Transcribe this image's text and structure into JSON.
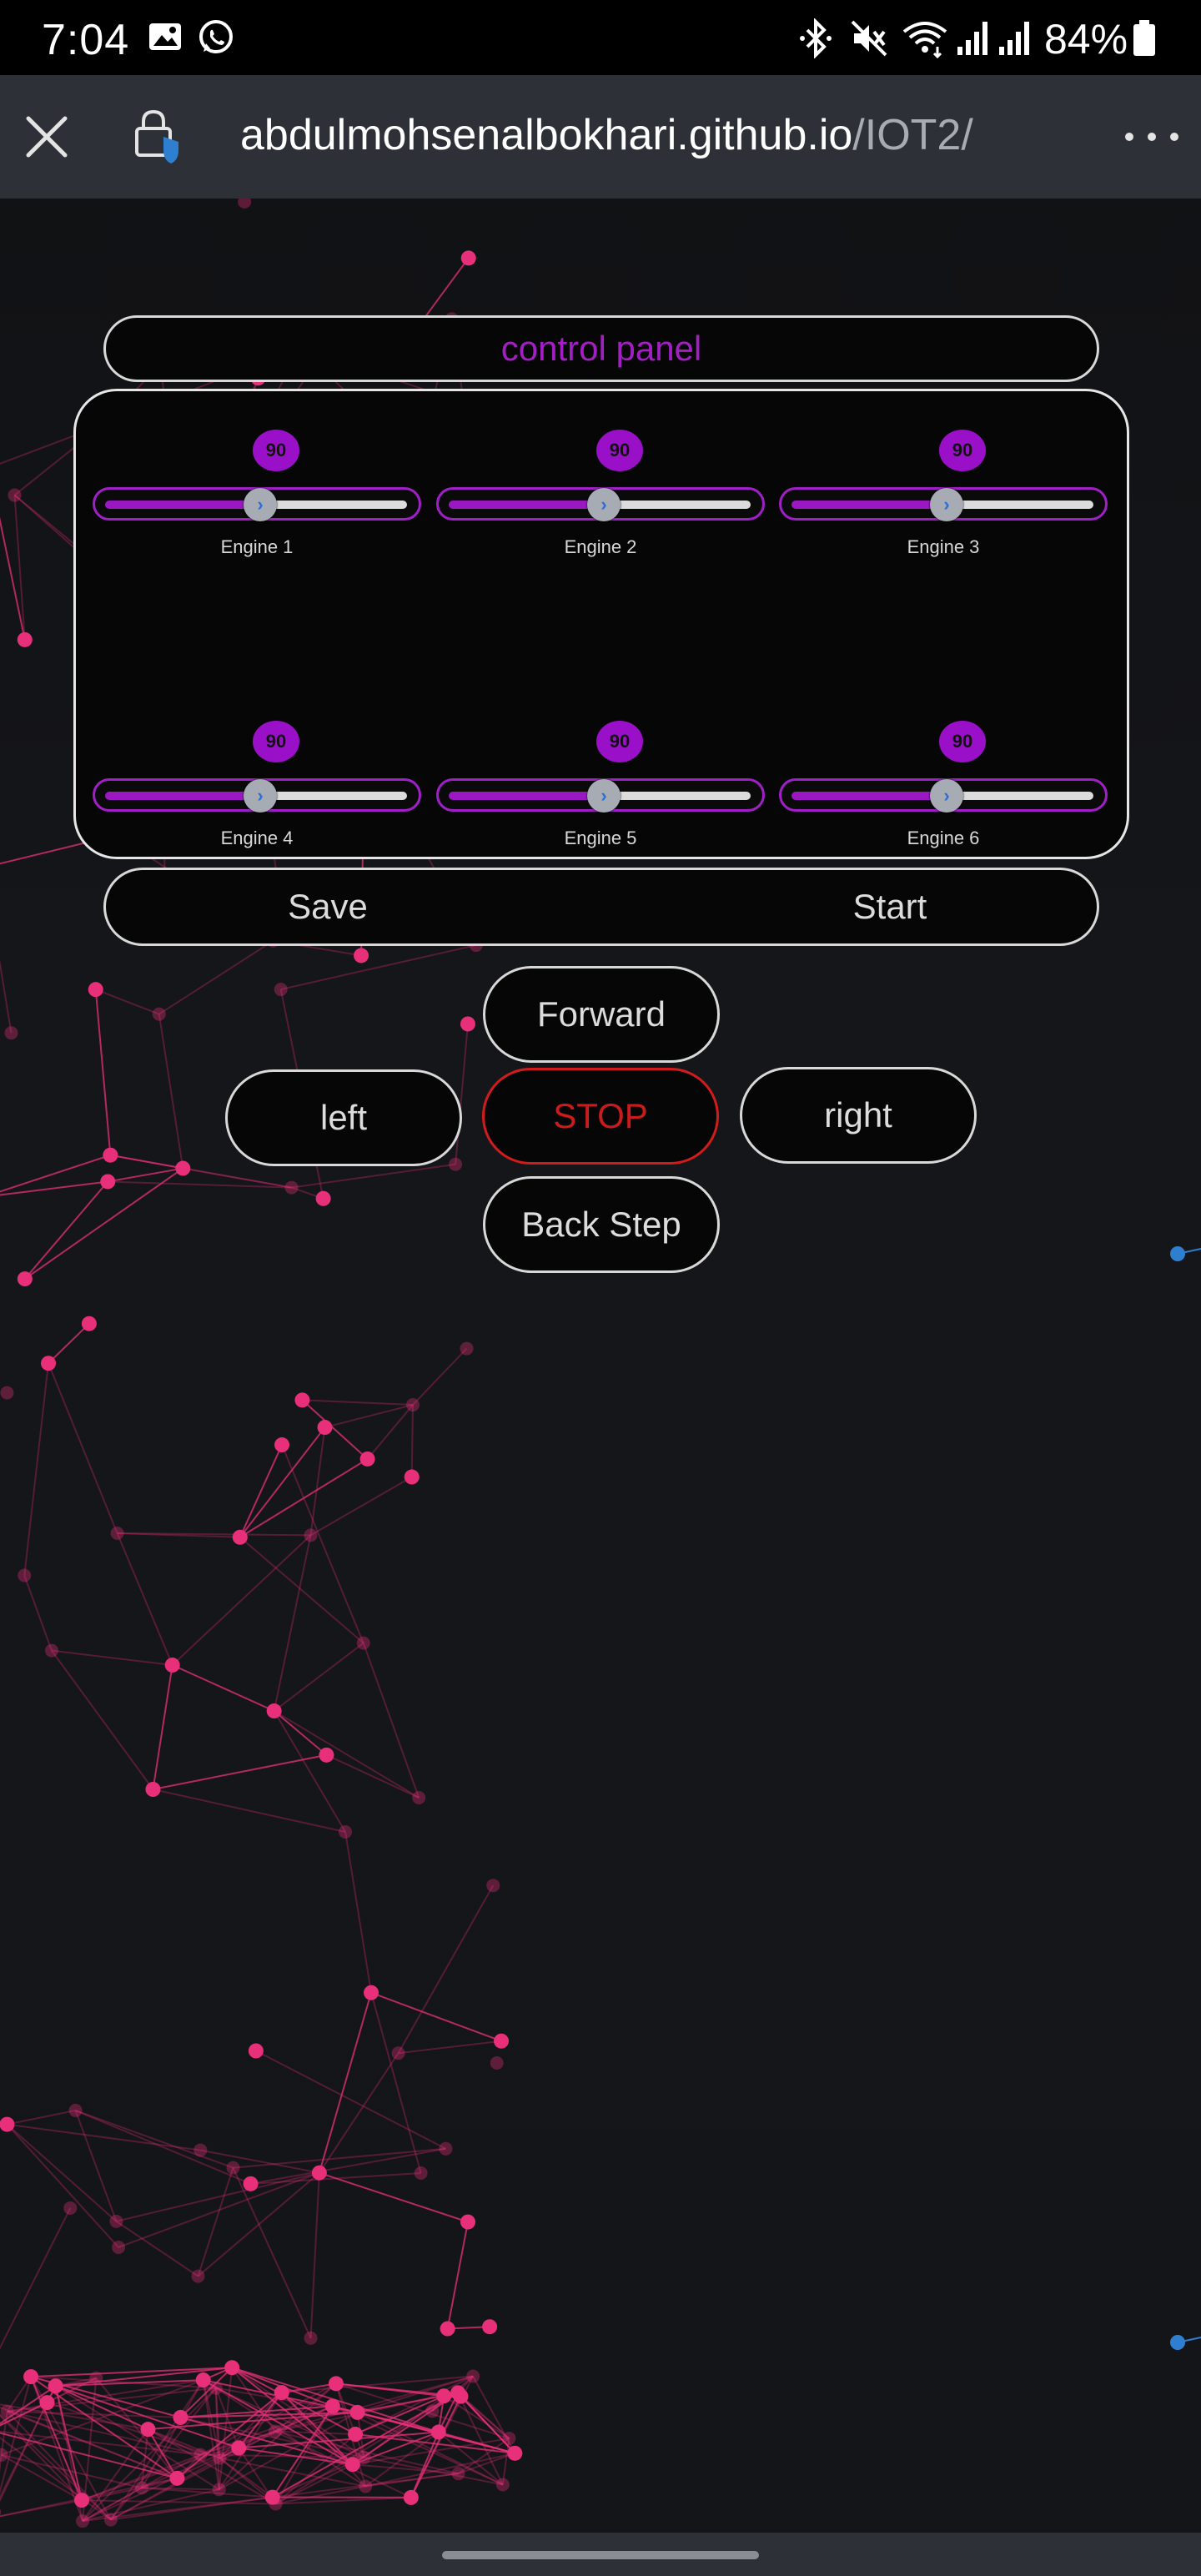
{
  "status_bar": {
    "time": "7:04",
    "battery": "84%",
    "icons": [
      "image-icon",
      "whatsapp-icon",
      "bluetooth-icon",
      "mute-icon",
      "wifi-icon",
      "signal-icon",
      "signal-icon",
      "battery-icon"
    ]
  },
  "address_bar": {
    "domain": "abdulmohsenalbokhari.github.io",
    "path": "/IOT2/",
    "icons": [
      "close-icon",
      "lock-icon",
      "more-icon"
    ]
  },
  "control_panel": {
    "title": "control panel",
    "engines": [
      {
        "label": "Engine 1",
        "value": "90",
        "fraction": 0.5
      },
      {
        "label": "Engine 2",
        "value": "90",
        "fraction": 0.5
      },
      {
        "label": "Engine 3",
        "value": "90",
        "fraction": 0.5
      },
      {
        "label": "Engine 4",
        "value": "90",
        "fraction": 0.5
      },
      {
        "label": "Engine 5",
        "value": "90",
        "fraction": 0.5
      },
      {
        "label": "Engine 6",
        "value": "90",
        "fraction": 0.5
      }
    ],
    "save_label": "Save",
    "start_label": "Start"
  },
  "direction_pad": {
    "forward": "Forward",
    "left": "left",
    "stop": "STOP",
    "right": "right",
    "back": "Back Step"
  },
  "colors": {
    "accent_purple": "#9a18c2",
    "title_purple": "#a21fc4",
    "stop_red": "#cc1b1b",
    "network_pink": "#e8307a",
    "network_blue": "#2f7fd1",
    "background": "#141518"
  }
}
